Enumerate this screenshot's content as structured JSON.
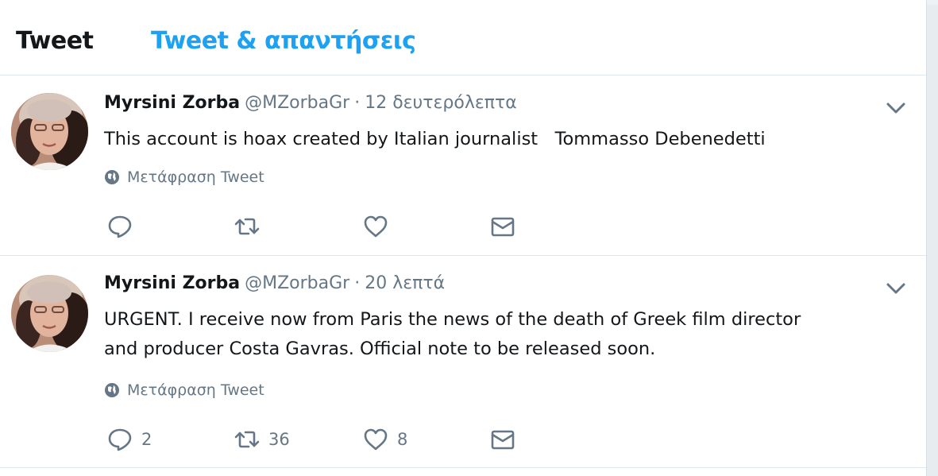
{
  "tabs": {
    "tweets": "Tweet",
    "tweets_replies": "Tweet & απαντήσεις"
  },
  "tweets": [
    {
      "name": "Myrsini Zorba",
      "handle": "@MZorbaGr",
      "separator": "·",
      "time": "12 δευτερόλεπτα",
      "text": "This account is hoax created by Italian journalist   Tommasso Debenedetti",
      "translate": "Μετάφραση Tweet",
      "replies": "",
      "retweets": "",
      "likes": ""
    },
    {
      "name": "Myrsini Zorba",
      "handle": "@MZorbaGr",
      "separator": "·",
      "time": "20 λεπτά",
      "text": "URGENT. I receive now from Paris the news of the death of Greek film director\nand producer Costa Gavras. Official note to be released soon.",
      "translate": "Μετάφραση Tweet",
      "replies": "2",
      "retweets": "36",
      "likes": "8"
    }
  ],
  "icons": {
    "reply": "reply-icon",
    "retweet": "retweet-icon",
    "like": "heart-icon",
    "dm": "envelope-icon",
    "translate": "globe-icon",
    "menu": "chevron-down-icon"
  },
  "colors": {
    "accent": "#1da1f2",
    "text": "#14171a",
    "muted": "#657786",
    "border": "#e1e8ed",
    "background": "#e6ecf0"
  }
}
